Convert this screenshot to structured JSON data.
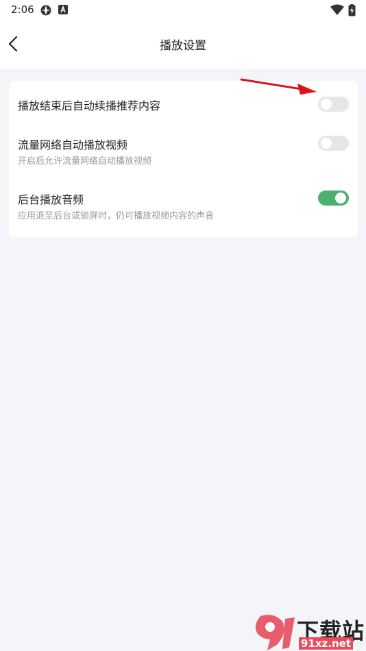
{
  "status_bar": {
    "time": "2:06",
    "icons": [
      "game-controller-icon",
      "accessibility-a-icon",
      "wifi-icon",
      "battery-charging-icon"
    ]
  },
  "header": {
    "title": "播放设置",
    "back_icon": "chevron-left-icon"
  },
  "settings": [
    {
      "title": "播放结束后自动续播推荐内容",
      "description": "",
      "enabled": false
    },
    {
      "title": "流量网络自动播放视频",
      "description": "开启后允许流量网络自动播放视频",
      "enabled": false
    },
    {
      "title": "后台播放音频",
      "description": "应用退至后台或锁屏时，仍可播放视频内容的声音",
      "enabled": true
    }
  ],
  "colors": {
    "toggle_on": "#4caf6e",
    "toggle_off": "#e6e6e6",
    "annotation_arrow": "#d9141b",
    "page_background": "#f4f5f9"
  },
  "watermark": {
    "name": "下载站",
    "domain": "91xz.net"
  }
}
